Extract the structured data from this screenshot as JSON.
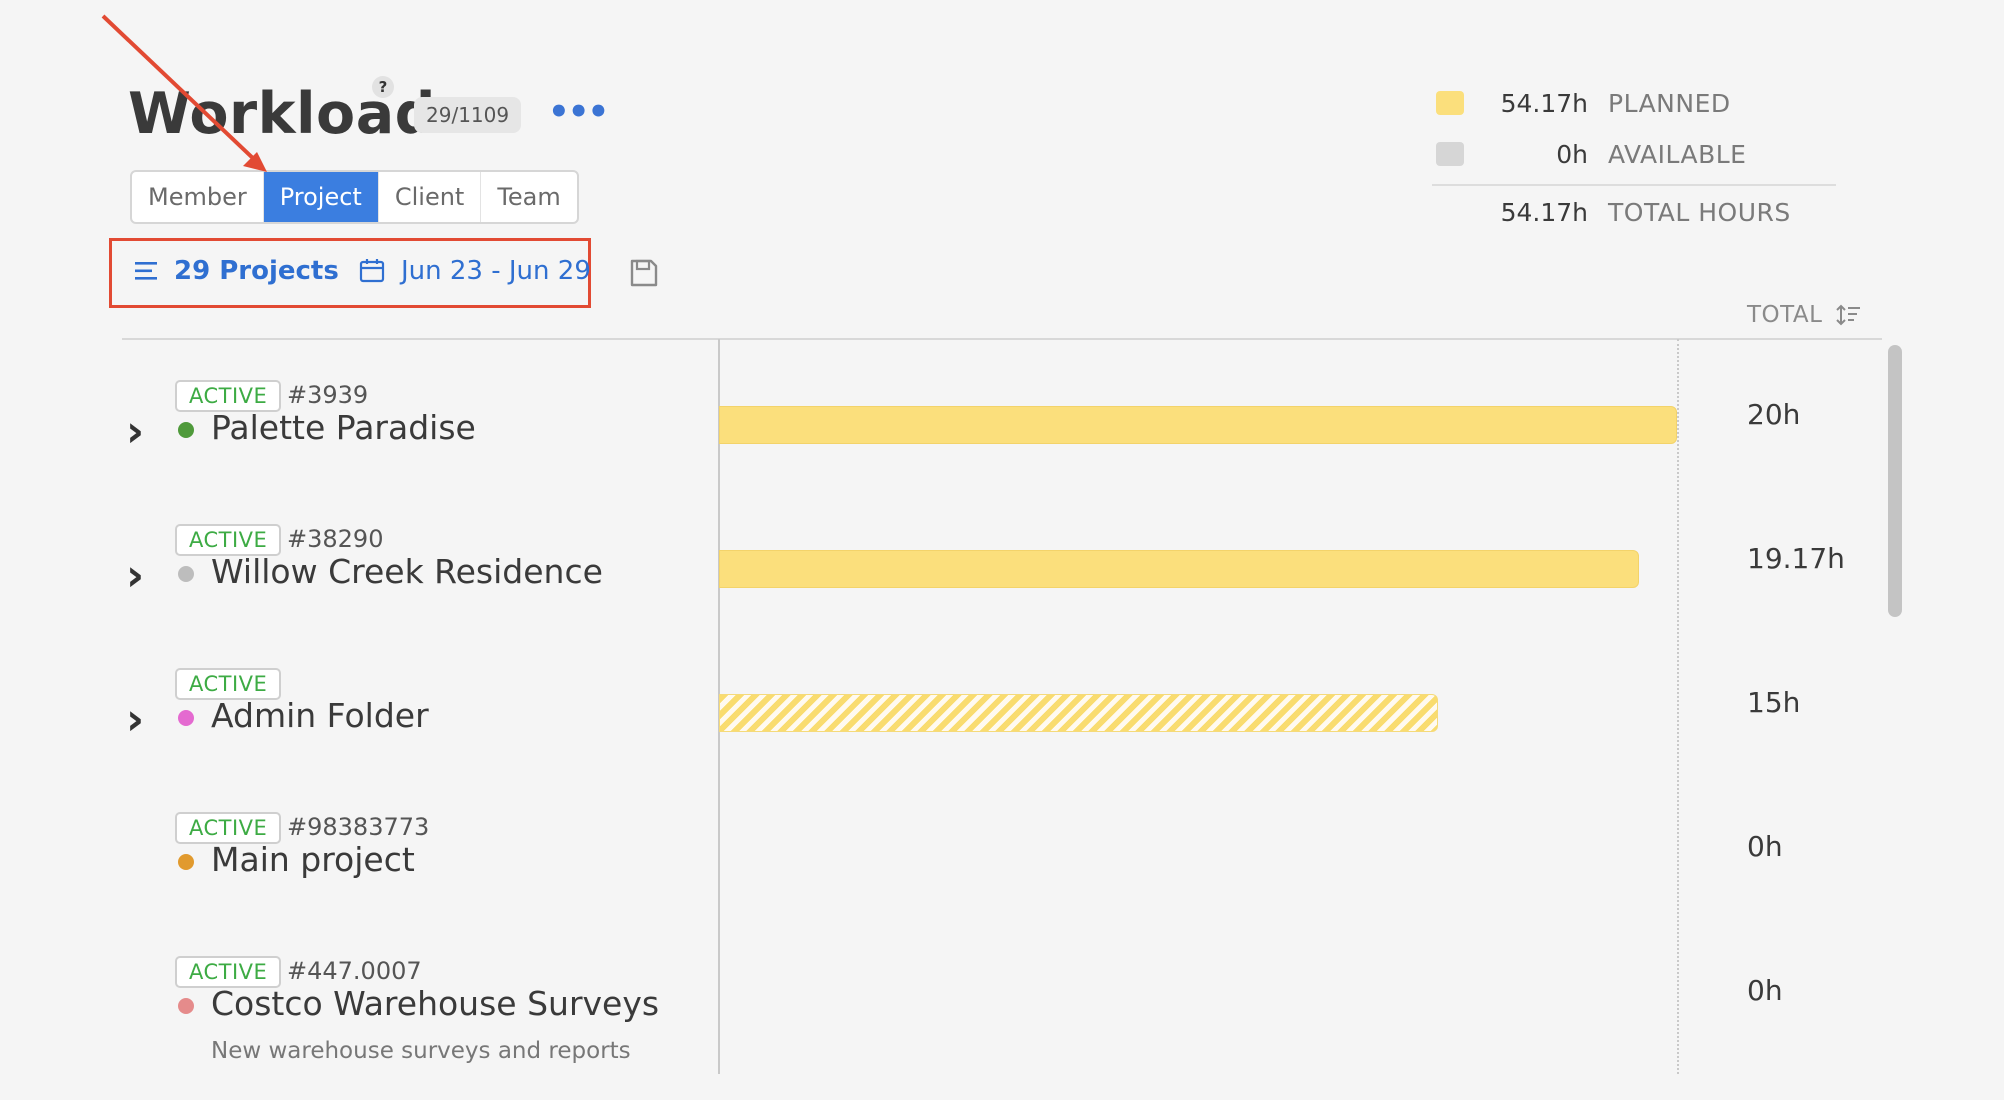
{
  "header": {
    "title": "Workload",
    "help": "?",
    "count": "29/1109",
    "more": "•••"
  },
  "view_tabs": [
    {
      "label": "Member",
      "active": false
    },
    {
      "label": "Project",
      "active": true
    },
    {
      "label": "Client",
      "active": false
    },
    {
      "label": "Team",
      "active": false
    }
  ],
  "filters": {
    "projects_label": "29 Projects",
    "date_range": "Jun 23 - Jun 29"
  },
  "legend": {
    "planned": {
      "value": "54.17h",
      "label": "PLANNED",
      "color": "#fbdf7c"
    },
    "available": {
      "value": "0h",
      "label": "AVAILABLE",
      "color": "#d6d6d6"
    },
    "total": {
      "value": "54.17h",
      "label": "TOTAL HOURS"
    }
  },
  "table": {
    "total_header": "TOTAL"
  },
  "rows": [
    {
      "status": "ACTIVE",
      "id": "#3939",
      "name": "Palette Paradise",
      "dot_color": "#4f9a3b",
      "hours": "20h",
      "planned_fraction": 1.0,
      "hatched": false,
      "expandable": true,
      "description": ""
    },
    {
      "status": "ACTIVE",
      "id": "#38290",
      "name": "Willow Creek Residence",
      "dot_color": "#bdbdbd",
      "hours": "19.17h",
      "planned_fraction": 0.96,
      "hatched": false,
      "expandable": true,
      "description": ""
    },
    {
      "status": "ACTIVE",
      "id": "",
      "name": "Admin Folder",
      "dot_color": "#e46ad0",
      "hours": "15h",
      "planned_fraction": 0.75,
      "hatched": true,
      "expandable": true,
      "description": ""
    },
    {
      "status": "ACTIVE",
      "id": "#98383773",
      "name": "Main project",
      "dot_color": "#e19a2e",
      "hours": "0h",
      "planned_fraction": 0,
      "hatched": false,
      "expandable": false,
      "description": ""
    },
    {
      "status": "ACTIVE",
      "id": "#447.0007",
      "name": "Costco Warehouse Surveys",
      "dot_color": "#e58b8b",
      "hours": "0h",
      "planned_fraction": 0,
      "hatched": false,
      "expandable": false,
      "description": "New warehouse surveys and reports"
    }
  ],
  "annotation": {
    "arrow_color": "#e24a33",
    "box_color": "#e24a33"
  }
}
